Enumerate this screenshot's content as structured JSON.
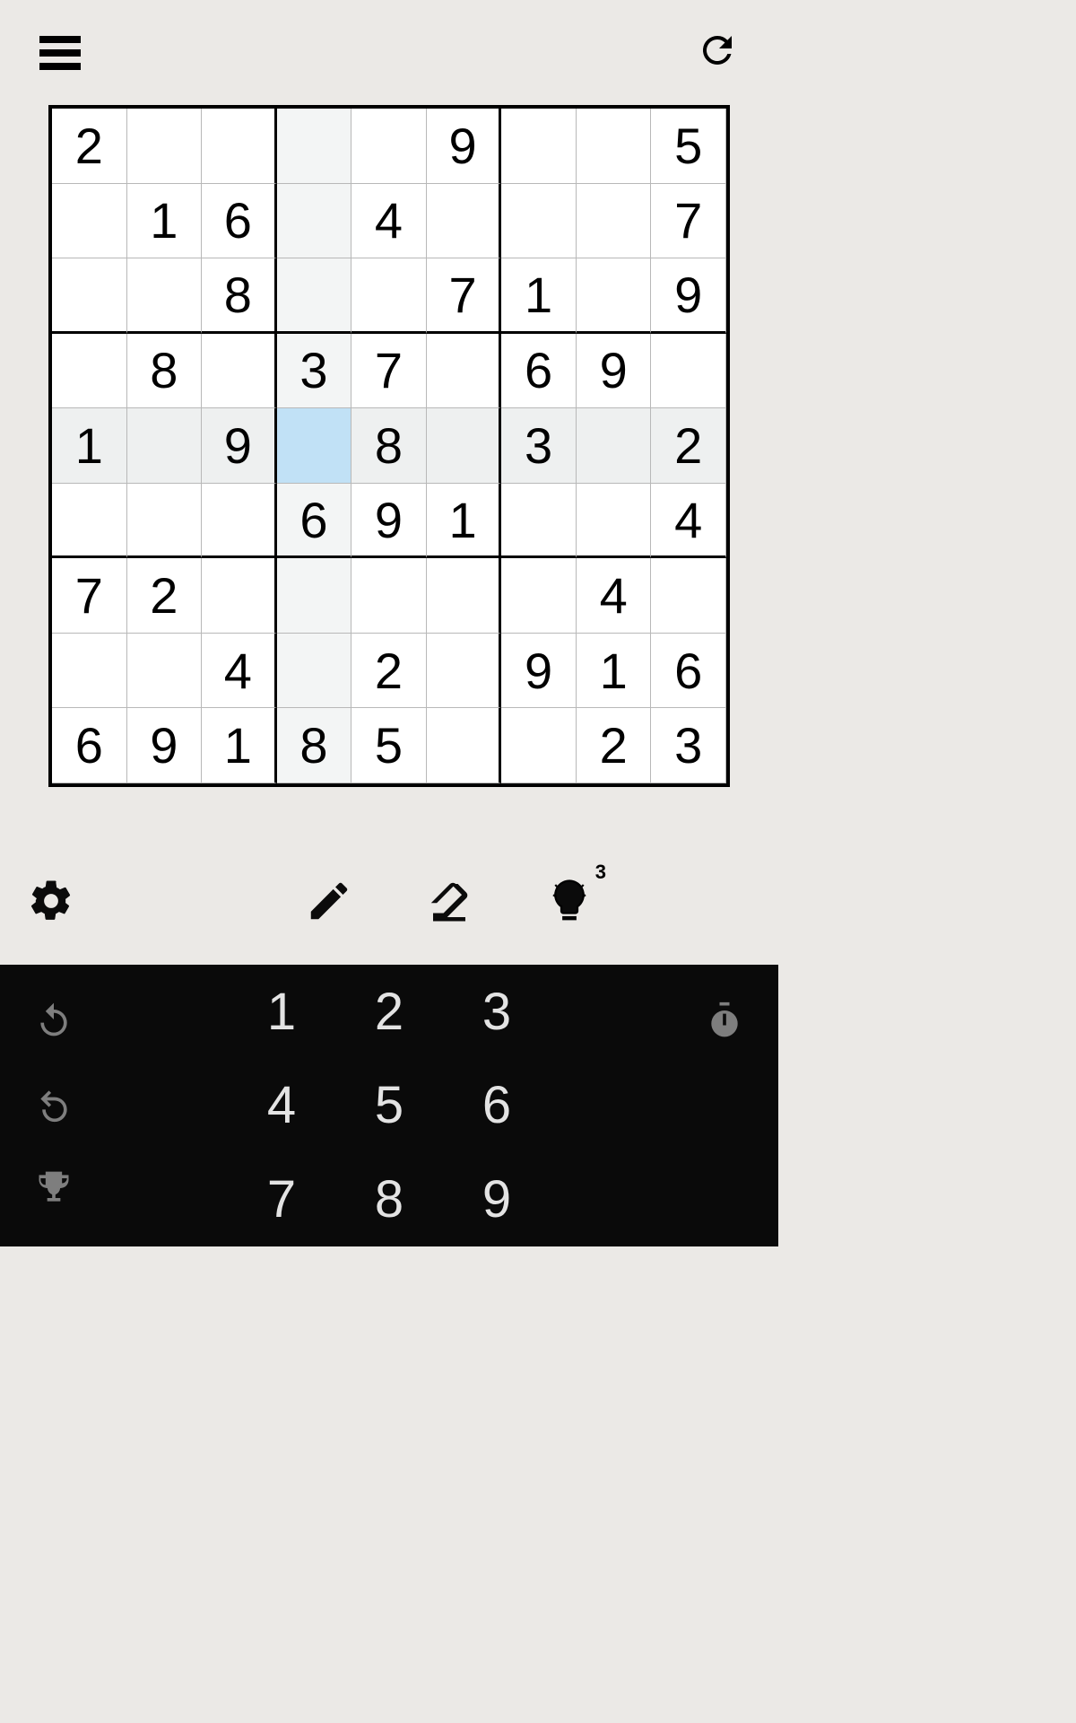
{
  "board": {
    "grid": [
      [
        "2",
        "",
        "",
        "",
        "",
        "9",
        "",
        "",
        "5"
      ],
      [
        "",
        "1",
        "6",
        "",
        "4",
        "",
        "",
        "",
        "7"
      ],
      [
        "",
        "",
        "8",
        "",
        "",
        "7",
        "1",
        "",
        "9"
      ],
      [
        "",
        "8",
        "",
        "3",
        "7",
        "",
        "6",
        "9",
        ""
      ],
      [
        "1",
        "",
        "9",
        "",
        "8",
        "",
        "3",
        "",
        "2"
      ],
      [
        "",
        "",
        "",
        "6",
        "9",
        "1",
        "",
        "",
        "4"
      ],
      [
        "7",
        "2",
        "",
        "",
        "",
        "",
        "",
        "4",
        ""
      ],
      [
        "",
        "",
        "4",
        "",
        "2",
        "",
        "9",
        "1",
        "6"
      ],
      [
        "6",
        "9",
        "1",
        "8",
        "5",
        "",
        "",
        "2",
        "3"
      ]
    ],
    "selected": {
      "row": 4,
      "col": 3
    },
    "highlight_col": 3,
    "highlight_row": 4
  },
  "toolbar": {
    "hint_count": "3"
  },
  "numpad": {
    "numbers": [
      "1",
      "2",
      "3",
      "4",
      "5",
      "6",
      "7",
      "8",
      "9"
    ]
  }
}
